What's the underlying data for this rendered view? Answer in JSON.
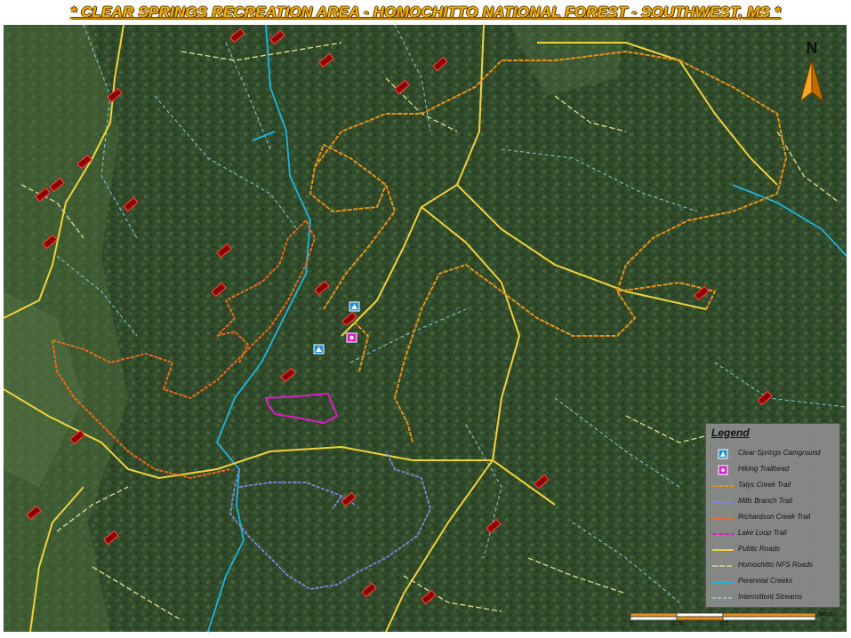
{
  "title": "* CLEAR SPRINGS RECREATION AREA - HOMOCHITTO NATIONAL FOREST - SOUTHWEST, MS *",
  "colors": {
    "forest": "#2f4a2a",
    "forest_light": "#3f5f34",
    "talys_creek": "#e8921a",
    "mills_branch": "#7f86e0",
    "richardson_creek": "#ff6a1a",
    "lake_loop": "#e01cc8",
    "public_roads": "#f0d23a",
    "nfs_roads": "#d8d88a",
    "perennial": "#1fb4e0",
    "intermittent": "#8fd6e8",
    "campground": "#1b8fd6",
    "trailhead": "#e01cc8"
  },
  "north_arrow": {
    "letter": "N"
  },
  "legend": {
    "title": "Legend",
    "items": [
      {
        "label": "Clear Springs Camground",
        "symbol": "campground-icon"
      },
      {
        "label": "Hiking Trailhead",
        "symbol": "trailhead-icon"
      },
      {
        "label": "Talys Creek Trail",
        "symbol": "talys-line"
      },
      {
        "label": "Mills Branch Trail",
        "symbol": "mills-line"
      },
      {
        "label": "Richardson Creek Trail",
        "symbol": "richardson-line"
      },
      {
        "label": "Lake Loop Trail",
        "symbol": "lake-line"
      },
      {
        "label": "Public Roads",
        "symbol": "public-road-line"
      },
      {
        "label": "Homochitto NFS Roads",
        "symbol": "nfs-road-line"
      },
      {
        "label": "Perennial Creeks",
        "symbol": "perennial-line"
      },
      {
        "label": "Intermittent Streams",
        "symbol": "intermittent-line"
      }
    ]
  },
  "scale": {
    "unit": "Miles",
    "ticks": [
      "0",
      "0.25",
      "0.5",
      "1"
    ]
  }
}
